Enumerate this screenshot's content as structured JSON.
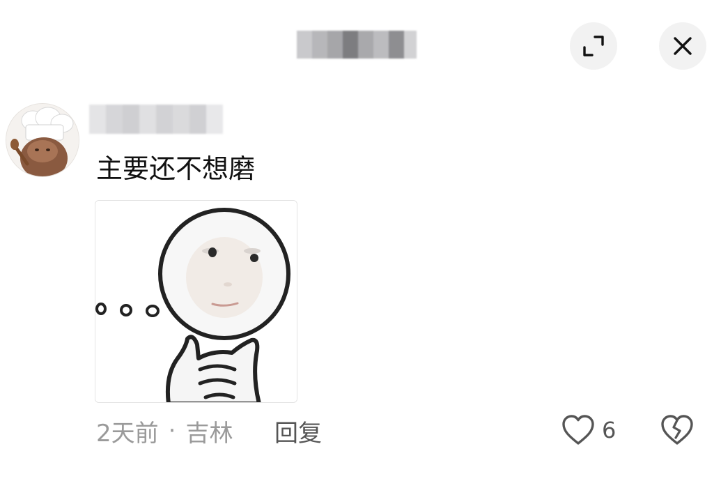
{
  "header": {
    "icons": {
      "expand": "expand-icon",
      "close": "close-icon"
    }
  },
  "comment": {
    "text": "主要还不想磨",
    "sticker": "thinking-meme-sticker",
    "meta": {
      "time": "2天前",
      "separator": "·",
      "location": "吉林"
    },
    "reply_label": "回复",
    "likes": "6",
    "icons": {
      "like": "heart-icon",
      "dislike": "broken-heart-icon"
    }
  }
}
